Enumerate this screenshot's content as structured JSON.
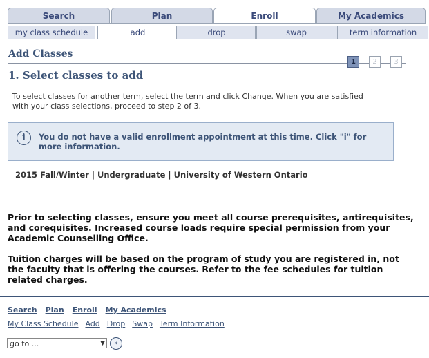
{
  "tabs": [
    "Search",
    "Plan",
    "Enroll",
    "My Academics"
  ],
  "active_tab": "Enroll",
  "subtabs": [
    "my class schedule",
    "add",
    "drop",
    "swap",
    "term information"
  ],
  "active_subtab": "add",
  "page": {
    "title": "Add Classes",
    "steps": [
      "1",
      "2",
      "3"
    ],
    "current_step": "1",
    "step_heading": "1.  Select classes to add",
    "instructions": "To select classes for another term, select the term and click Change. When you are satisfied with your class selections, proceed to step 2 of 3.",
    "info_icon": "info-icon",
    "info_message": "You do not have a valid enrollment appointment at this time. Click \"i\" for more information.",
    "term": "2015 Fall/Winter | Undergraduate | University of Western Ontario",
    "paragraph1": "Prior to selecting classes, ensure you meet all course prerequisites, antirequisites, and corequisites. Increased course loads require special permission from your Academic Counselling Office.",
    "paragraph2": "Tuition charges will be based on the program of study you are registered in, not the faculty that is offering the courses. Refer to the fee schedules for tuition related charges."
  },
  "footer": {
    "main_links": [
      "Search",
      "Plan",
      "Enroll",
      "My Academics"
    ],
    "sub_links": [
      "My Class Schedule",
      "Add",
      "Drop",
      "Swap",
      "Term Information"
    ],
    "goto_label": "go to ...",
    "goto_arrow": "▼",
    "go_button": "»"
  },
  "colors": {
    "accent": "#3e5578",
    "tab_bg": "#d3d9e6",
    "info_bg": "#e3eaf3"
  }
}
